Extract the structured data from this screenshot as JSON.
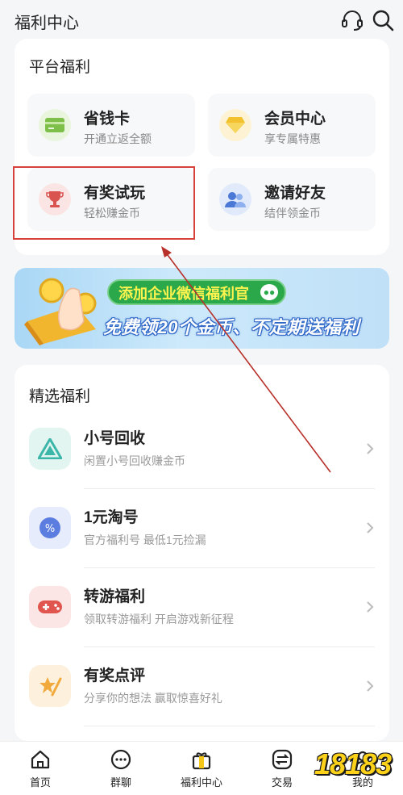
{
  "header": {
    "title": "福利中心",
    "icons": [
      "headset-icon",
      "search-icon"
    ]
  },
  "platform": {
    "title": "平台福利",
    "tiles": [
      {
        "title": "省钱卡",
        "subtitle": "开通立返全额",
        "icon": "card-icon",
        "color": "#7dbf48"
      },
      {
        "title": "会员中心",
        "subtitle": "享专属特惠",
        "icon": "diamond-icon",
        "color": "#f3c12f"
      },
      {
        "title": "有奖试玩",
        "subtitle": "轻松赚金币",
        "icon": "trophy-icon",
        "color": "#d9534f"
      },
      {
        "title": "邀请好友",
        "subtitle": "结伴领金币",
        "icon": "friends-icon",
        "color": "#4a78d6"
      }
    ]
  },
  "banner": {
    "line1": "添加企业微信福利官",
    "line2": "免费领20个金币、不定期送福利"
  },
  "featured": {
    "title": "精选福利",
    "items": [
      {
        "title": "小号回收",
        "subtitle": "闲置小号回收赚金币",
        "icon": "recycle-icon",
        "color": "#3bb6a8"
      },
      {
        "title": "1元淘号",
        "subtitle": "官方福利号 最低1元捡漏",
        "icon": "percent-badge-icon",
        "color": "#5b7de0"
      },
      {
        "title": "转游福利",
        "subtitle": "领取转游福利 开启游戏新征程",
        "icon": "gamepad-icon",
        "color": "#e0564f"
      },
      {
        "title": "有奖点评",
        "subtitle": "分享你的想法 赢取惊喜好礼",
        "icon": "pen-star-icon",
        "color": "#f2a93b"
      }
    ]
  },
  "tabbar": {
    "tabs": [
      {
        "label": "首页",
        "icon": "home-icon"
      },
      {
        "label": "群聊",
        "icon": "chat-icon"
      },
      {
        "label": "福利中心",
        "icon": "gift-icon"
      },
      {
        "label": "交易",
        "icon": "exchange-icon"
      },
      {
        "label": "我的",
        "icon": "profile-icon"
      }
    ]
  },
  "watermark": {
    "text": "18183"
  },
  "colors": {
    "highlight": "#d6423b",
    "arrow": "#b8302a"
  }
}
